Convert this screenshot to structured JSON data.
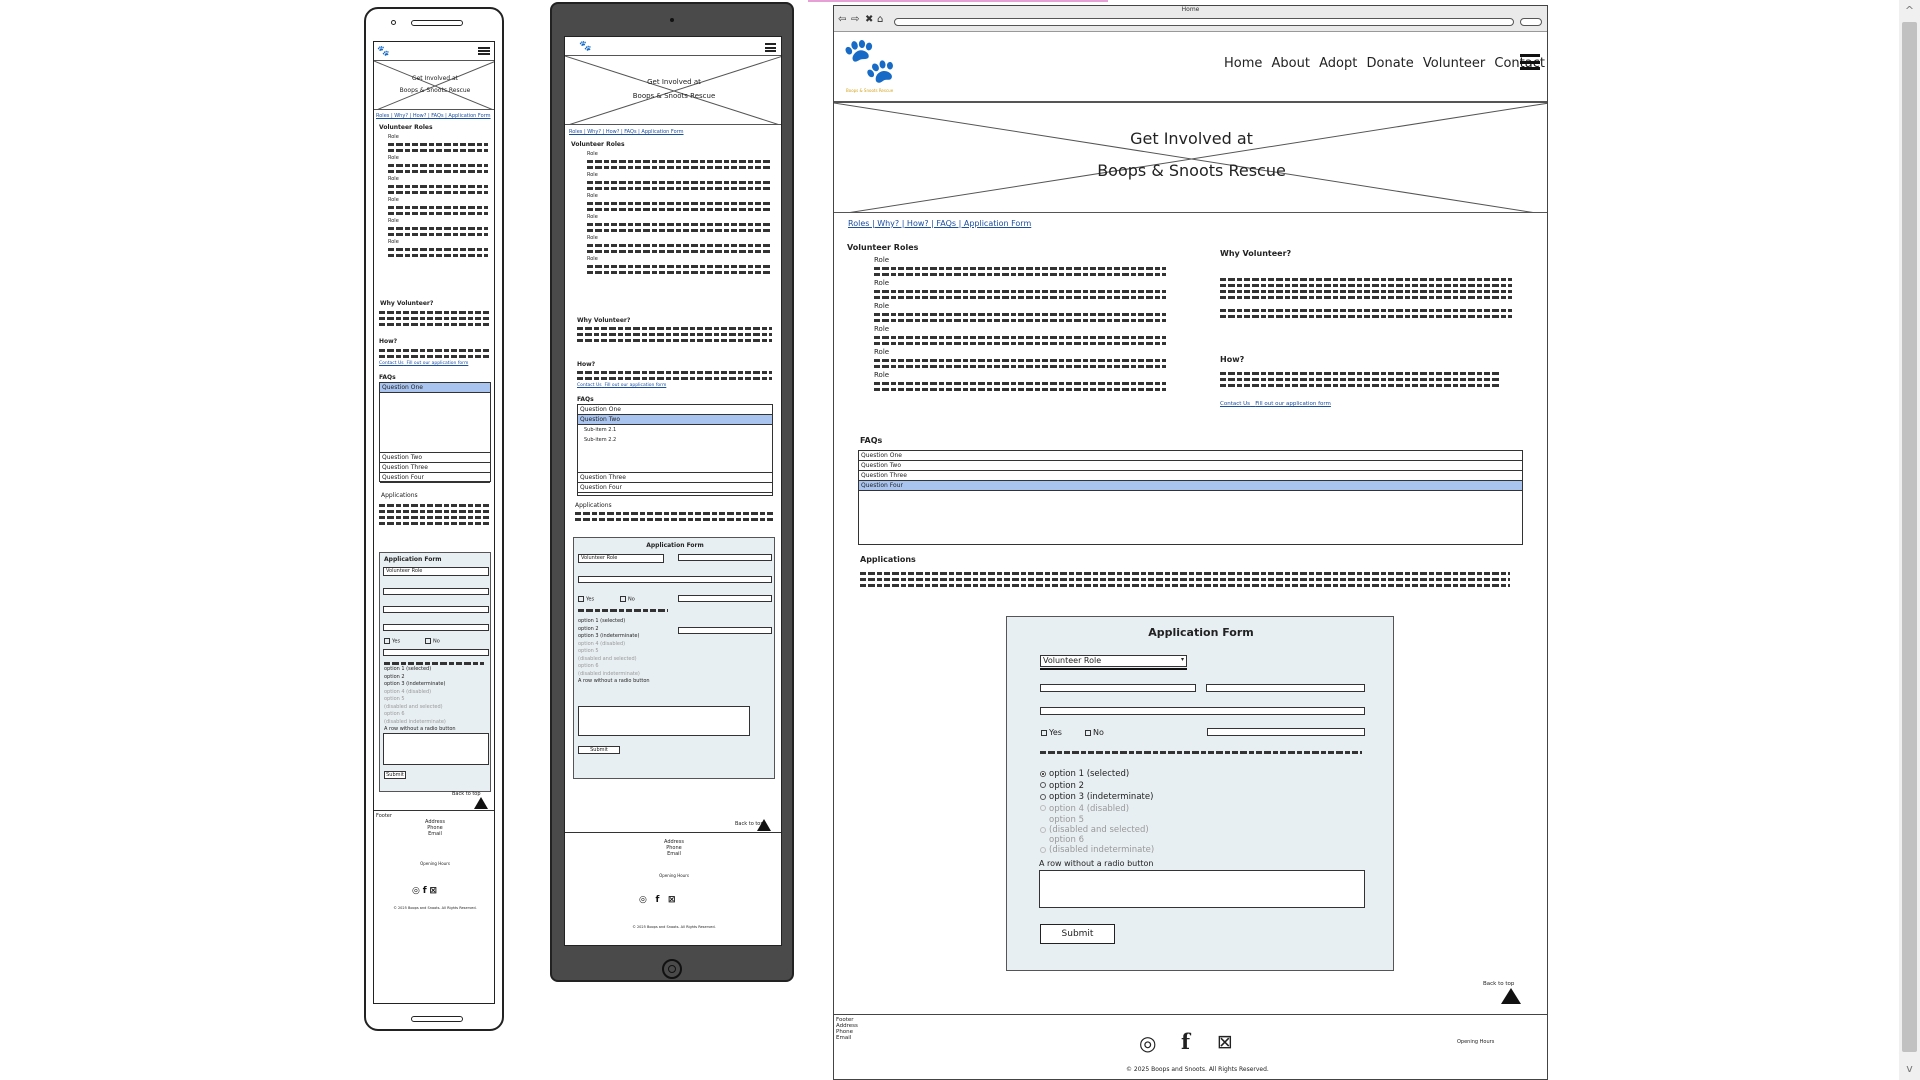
{
  "browser": {
    "title": "Home",
    "nav_icons": [
      "back-icon",
      "forward-icon",
      "stop-icon",
      "home-icon"
    ]
  },
  "brand": {
    "logo_text": "Boops & Snoots Rescue",
    "logo_color": "#d4a21a"
  },
  "nav": {
    "items": [
      "Home",
      "About",
      "Adopt",
      "Donate",
      "Volunteer",
      "Contact"
    ]
  },
  "hero": {
    "line1": "Get Involved at",
    "line2": "Boops & Snoots Rescue"
  },
  "anchor_links": "Roles | Why? | How? | FAQs | Application Form",
  "sections": {
    "roles_heading": "Volunteer Roles",
    "role_label": "Role",
    "why_heading": "Why Volunteer?",
    "how_heading": "How?",
    "contact_link": "Contact Us",
    "apply_link": "Fill out our application form",
    "faqs_heading": "FAQs",
    "applications_heading": "Applications"
  },
  "faqs": {
    "questions": [
      "Question One",
      "Question Two",
      "Question Three",
      "Question Four"
    ],
    "sub_items": [
      "Sub-item 2.1",
      "Sub-item 2.2"
    ]
  },
  "form": {
    "title": "Application Form",
    "select_value": "Volunteer Role",
    "yes_label": "Yes",
    "no_label": "No",
    "options": [
      {
        "label": "option 1 (selected)",
        "disabled": false
      },
      {
        "label": "option 2",
        "disabled": false
      },
      {
        "label": "option 3 (indeterminate)",
        "disabled": false
      },
      {
        "label": "option 4 (disabled)",
        "disabled": true
      },
      {
        "label": "option 5",
        "sub": "(disabled and selected)",
        "disabled": true
      },
      {
        "label": "option 6",
        "sub": "(disabled indeterminate)",
        "disabled": true
      }
    ],
    "row_without_radio": "A row without a radio button",
    "submit_label": "Submit"
  },
  "back_to_top": "Back to top",
  "footer": {
    "label": "Footer",
    "address": "Address",
    "phone": "Phone",
    "email": "Email",
    "opening_hours": "Opening Hours",
    "copyright": "© 2025 Boops and Snoots. All Rights Reserved.",
    "social": [
      "instagram-icon",
      "facebook-icon",
      "x-icon"
    ]
  },
  "colors": {
    "selected_row": "#a8c4ef",
    "form_panel_bg": "#e8eff2",
    "link": "#1a4fa0",
    "tablet_frame": "#4a4a4a"
  }
}
